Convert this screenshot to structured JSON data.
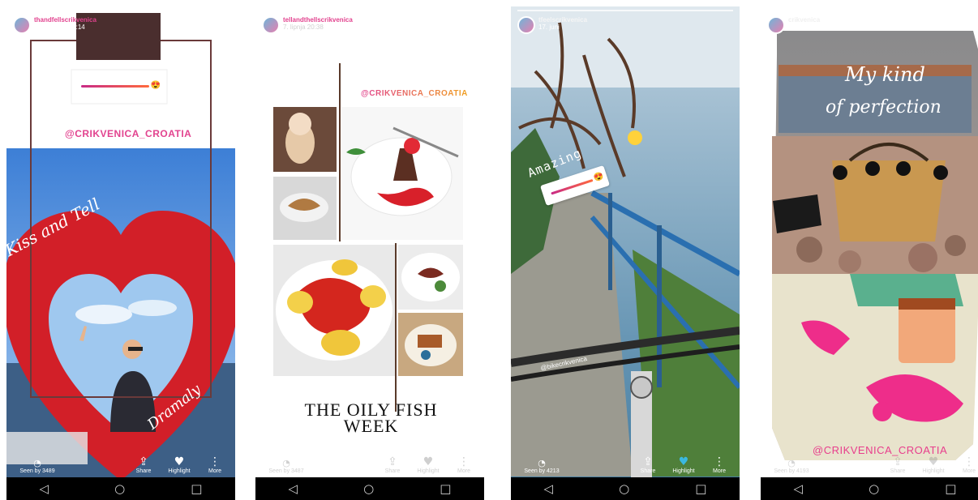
{
  "nav": {
    "back": "◁",
    "home": "○",
    "recents": "□"
  },
  "stories": [
    {
      "username": "thandfellscrikvenica",
      "time": "2. kolovoza 13:14",
      "mention": "@CRIKVENICA_CROATIA",
      "heart_text_left": "Kiss and Tell",
      "heart_text_right": "Dramaly",
      "seen": "Seen by 3489",
      "actions": [
        "Share",
        "Highlight",
        "More"
      ]
    },
    {
      "username": "tellandthellscrikvenica",
      "time": "7. lipnja 20:38",
      "mention": "@CRIKVENICA_CROATIA",
      "title": "THE OILY FISH WEEK",
      "seen": "Seen by 3487",
      "actions": [
        "Share",
        "Highlight",
        "More"
      ]
    },
    {
      "username": "tfeelscrikvenica",
      "time": "17. juni",
      "sticker_text": "Amazing",
      "bike_mention": "@bikecrikvenica",
      "seen": "Seen by 4213",
      "actions": [
        "Share",
        "Highlight",
        "More"
      ]
    },
    {
      "username": "crikvenica",
      "time": "2. juni",
      "headline_1": "My kind",
      "headline_2": "of perfection",
      "mention": "@CRIKVENICA_CROATIA",
      "seen": "Seen by 4193",
      "actions": [
        "Share",
        "Highlight",
        "More"
      ]
    }
  ]
}
